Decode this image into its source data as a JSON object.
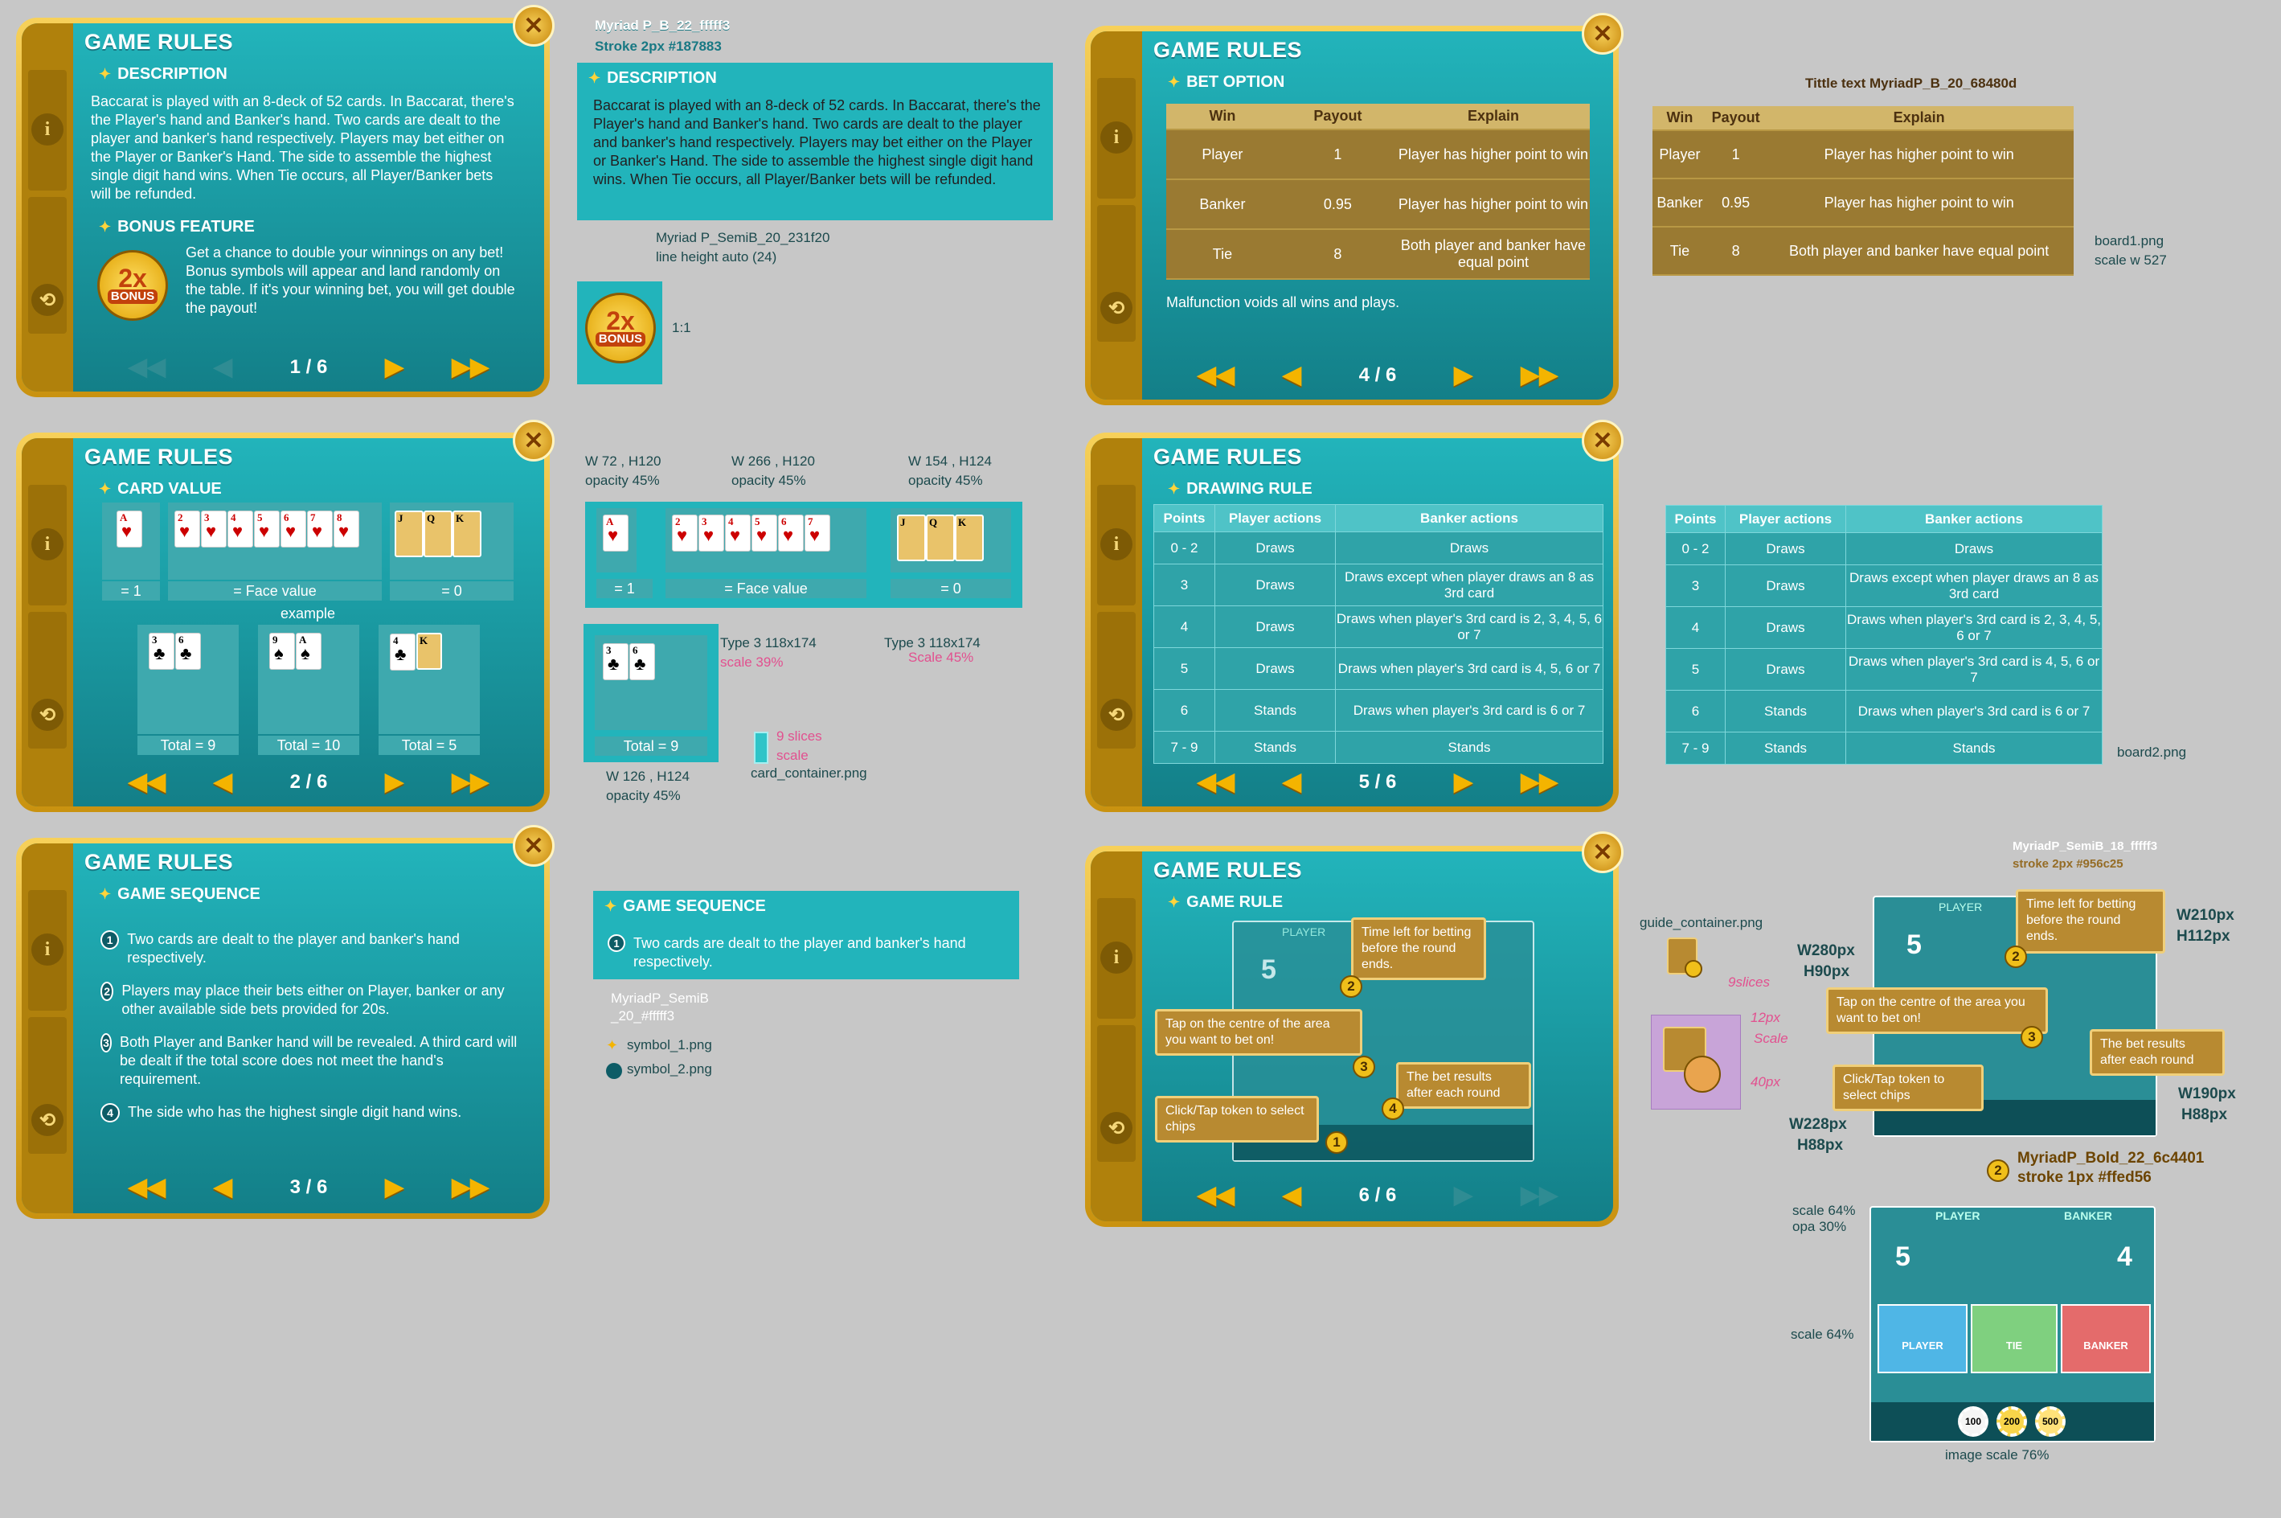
{
  "panel_title": "GAME RULES",
  "close_glyph": "✕",
  "info_glyph": "i",
  "history_glyph": "⟲",
  "panels": {
    "p1": {
      "page": "1 / 6",
      "sec1": "DESCRIPTION",
      "desc": "Baccarat is played with an 8-deck of 52 cards. In Baccarat, there's the Player's hand and Banker's hand. Two cards are dealt to the player and banker's hand respectively. Players may bet either on the Player or Banker's Hand. The side to assemble the highest single digit hand wins. When Tie occurs, all Player/Banker bets will be refunded.",
      "sec2": "BONUS FEATURE",
      "bonus": "Get a chance to double your winnings on any bet! Bonus symbols will appear and land randomly on the table. If it's your winning bet, you will get double the payout!"
    },
    "p2": {
      "page": "2 / 6",
      "sec": "CARD VALUE",
      "label_a": "= 1",
      "label_b": "= Face value",
      "label_c": "= 0",
      "example": "example",
      "total1": "Total = 9",
      "total2": "Total = 10",
      "total3": "Total = 5"
    },
    "p3": {
      "page": "3 / 6",
      "sec": "GAME SEQUENCE",
      "items": [
        "Two cards are dealt to the player and banker's hand respectively.",
        "Players may place their bets either on Player, banker or any other available side bets provided for 20s.",
        "Both Player and Banker hand will be revealed. A third card will be dealt if the total score does not meet the hand's requirement.",
        "The side who has the highest single digit hand wins."
      ]
    },
    "p4": {
      "page": "4 / 6",
      "sec": "BET OPTION",
      "headers": [
        "Win",
        "Payout",
        "Explain"
      ],
      "rows": [
        [
          "Player",
          "1",
          "Player has higher point to win"
        ],
        [
          "Banker",
          "0.95",
          "Player has higher point to win"
        ],
        [
          "Tie",
          "8",
          "Both player and banker have equal point"
        ]
      ],
      "note": "Malfunction voids all wins and plays."
    },
    "p5": {
      "page": "5 / 6",
      "sec": "DRAWING RULE",
      "headers": [
        "Points",
        "Player actions",
        "Banker actions"
      ],
      "rows": [
        [
          "0 - 2",
          "Draws",
          "Draws"
        ],
        [
          "3",
          "Draws",
          "Draws except when player draws an 8 as 3rd card"
        ],
        [
          "4",
          "Draws",
          "Draws when player's 3rd card is 2, 3, 4, 5, 6 or 7"
        ],
        [
          "5",
          "Draws",
          "Draws when player's 3rd card is 4, 5, 6 or 7"
        ],
        [
          "6",
          "Stands",
          "Draws when player's 3rd card is 6 or 7"
        ],
        [
          "7 - 9",
          "Stands",
          "Stands"
        ]
      ]
    },
    "p6": {
      "page": "6 / 6",
      "sec": "GAME RULE",
      "c1": "Click/Tap token to select chips",
      "c2": "Time left for betting before the round ends.",
      "c3": "Tap on the centre of the area you want to bet on!",
      "c4": "The bet results after each round"
    }
  },
  "badge": {
    "big": "2x",
    "small": "BONUS"
  },
  "spec": {
    "font1": "Myriad P_B_22_fffff3",
    "stroke1": "Stroke 2px #187883",
    "font2": "Myriad P_SemiB_20_231f20",
    "lineheight": "line height auto (24)",
    "ratio": "1:1",
    "w1": "W 72 , H120",
    "w2": "W 266 , H120",
    "w3": "W 154 , H124",
    "opa": "opacity 45%",
    "type3a": "Type 3 118x174",
    "scale39": "scale 39%",
    "type3b": "Type 3 118x174",
    "scale45": "Scale 45%",
    "nine_slices": "9 slices",
    "scale_word": "scale",
    "card_container": "card_container.png",
    "w4": "W 126 , H124",
    "font3a": "MyriadP_SemiB",
    "font3b": "_20_#fffff3",
    "symbol1": "symbol_1.png",
    "symbol2": "symbol_2.png",
    "title_text": "Tittle text MyriadP_B_20_68480d",
    "board1": "board1.png",
    "scale527": "scale w 527",
    "board2": "board2.png",
    "guide_container": "guide_container.png",
    "slices9": "9slices",
    "px12": "12px",
    "scale_w": "Scale",
    "px40": "40px",
    "font4": "MyriadP_SemiB_18_fffff3",
    "stroke4": "stroke 2px #956c25",
    "w280": "W280px",
    "h90": "H90px",
    "w210": "W210px",
    "h112": "H112px",
    "w190": "W190px",
    "h88a": "H88px",
    "w228": "W228px",
    "h88b": "H88px",
    "font5": "MyriadP_Bold_22_6c4401",
    "stroke5": "stroke 1px #ffed56",
    "scale64a": "scale 64%",
    "opa30": "opa 30%",
    "scale64b": "scale 64%",
    "image_scale": "image scale 76%"
  },
  "mini_game": {
    "player": "PLAYER",
    "banker": "BANKER",
    "player_score": "5",
    "banker_score": "4",
    "tie": "TIE",
    "odds": "1:1",
    "chips": [
      "100",
      "200",
      "500"
    ]
  },
  "colors": {
    "teal": "#1c9ea6",
    "gold": "#f0c040",
    "board": "#9a7a32"
  }
}
